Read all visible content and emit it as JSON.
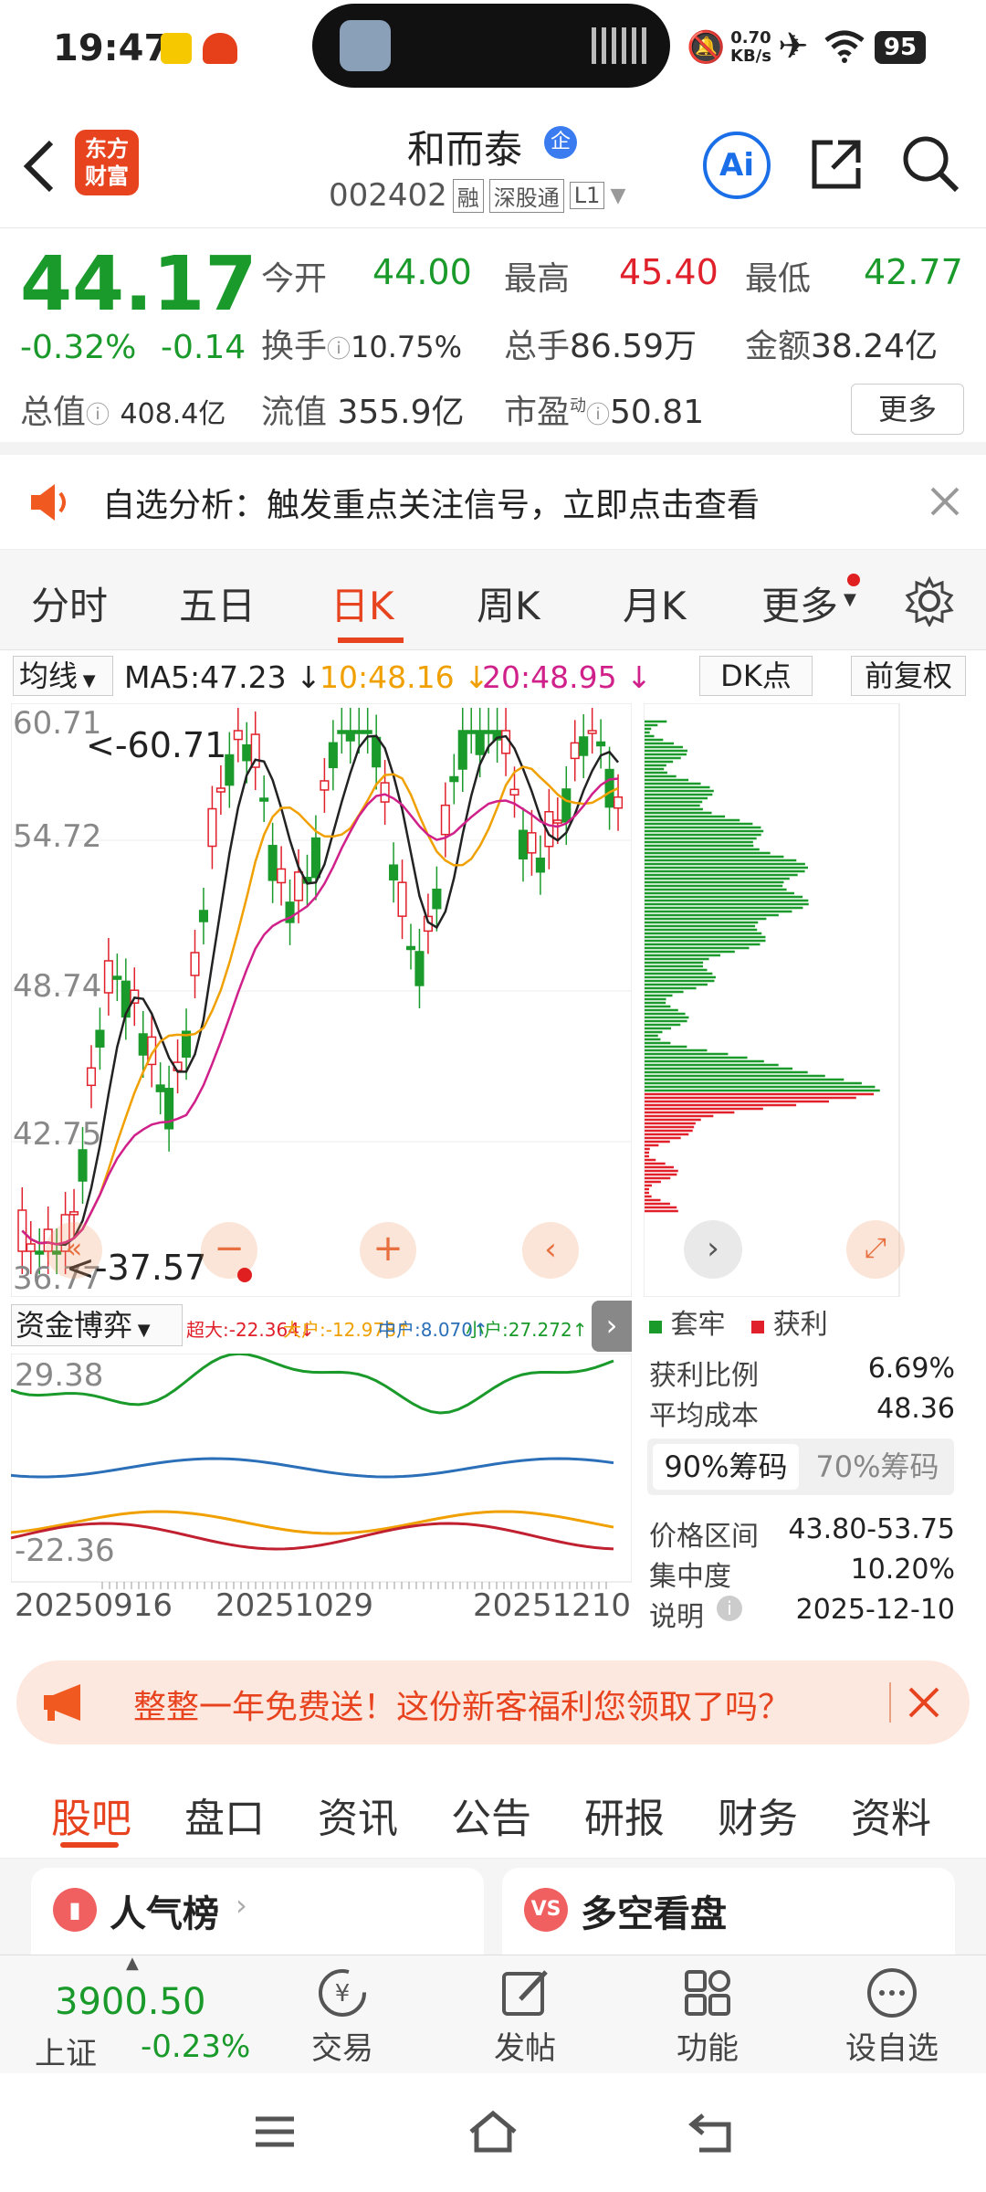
{
  "status": {
    "time": "19:47",
    "net_speed_top": "0.70",
    "net_speed_unit": "KB/s",
    "battery": "95"
  },
  "header": {
    "logo": "东方财富",
    "stock_name": "和而泰",
    "stock_code": "002402",
    "tag_rong": "融",
    "tag_sgt": "深股通",
    "tag_l1": "L1"
  },
  "quote": {
    "price": "44.17",
    "change_pct": "-0.32%",
    "change": "-0.14",
    "open_label": "今开",
    "open": "44.00",
    "high_label": "最高",
    "high": "45.40",
    "low_label": "最低",
    "low": "42.77",
    "turnover_label": "换手",
    "turnover": "10.75%",
    "vol_label": "总手",
    "vol": "86.59万",
    "amount_label": "金额",
    "amount": "38.24亿",
    "mcap_label": "总值",
    "mcap": "408.4亿",
    "float_label": "流值",
    "float": "355.9亿",
    "pe_label": "市盈",
    "pe_sup": "动",
    "pe": "50.81",
    "more_btn": "更多"
  },
  "notice": {
    "text": "自选分析：触发重点关注信号，立即点击查看"
  },
  "ktabs": [
    "分时",
    "五日",
    "日K",
    "周K",
    "月K",
    "更多"
  ],
  "ma": {
    "dropdown": "均线",
    "ma5": "MA5:47.23 ↓",
    "ma10": "10:48.16 ↓",
    "ma20": "20:48.95 ↓",
    "dk_btn": "DK点",
    "fq_btn": "前复权"
  },
  "kchart_labels": {
    "y1": "60.71",
    "y2": "54.72",
    "y3": "48.74",
    "y4": "42.75",
    "y5": "36.77",
    "max_note": "<-60.71",
    "min_note": "<-37.57"
  },
  "chip_legend": {
    "trapped": "套牢",
    "profit": "获利"
  },
  "chip_info": {
    "profit_ratio_label": "获利比例",
    "profit_ratio": "6.69%",
    "avg_cost_label": "平均成本",
    "avg_cost": "48.36",
    "tab90": "90%筹码",
    "tab70": "70%筹码",
    "range_label": "价格区间",
    "range": "43.80-53.75",
    "conc_label": "集中度",
    "conc": "10.20%",
    "note_label": "说明",
    "note_date": "2025-12-10"
  },
  "zj": {
    "dropdown": "资金博弈",
    "super": "超大:-22.364↓",
    "big": "大户:-12.978↑",
    "mid": "中户:8.070↑",
    "small": "小户:27.272↑",
    "y_top": "29.38",
    "y_bot": "-22.36",
    "d1": "20250916",
    "d2": "20251029",
    "d3": "20251210"
  },
  "banner": {
    "text": "整整一年免费送！这份新客福利您领取了吗？"
  },
  "btabs": [
    "股吧",
    "盘口",
    "资讯",
    "公告",
    "研报",
    "财务",
    "资料"
  ],
  "cards": {
    "left": "人气榜",
    "right": "多空看盘"
  },
  "bottomnav": {
    "index_val": "3900.50",
    "index_name": "上证",
    "index_chg": "-0.23%",
    "trade": "交易",
    "post": "发帖",
    "func": "功能",
    "add": "设自选"
  },
  "colors": {
    "up": "#e0202a",
    "down": "#1a9a2a",
    "ma10": "#f0a000",
    "ma20": "#d0208a",
    "ma5": "#222222"
  }
}
